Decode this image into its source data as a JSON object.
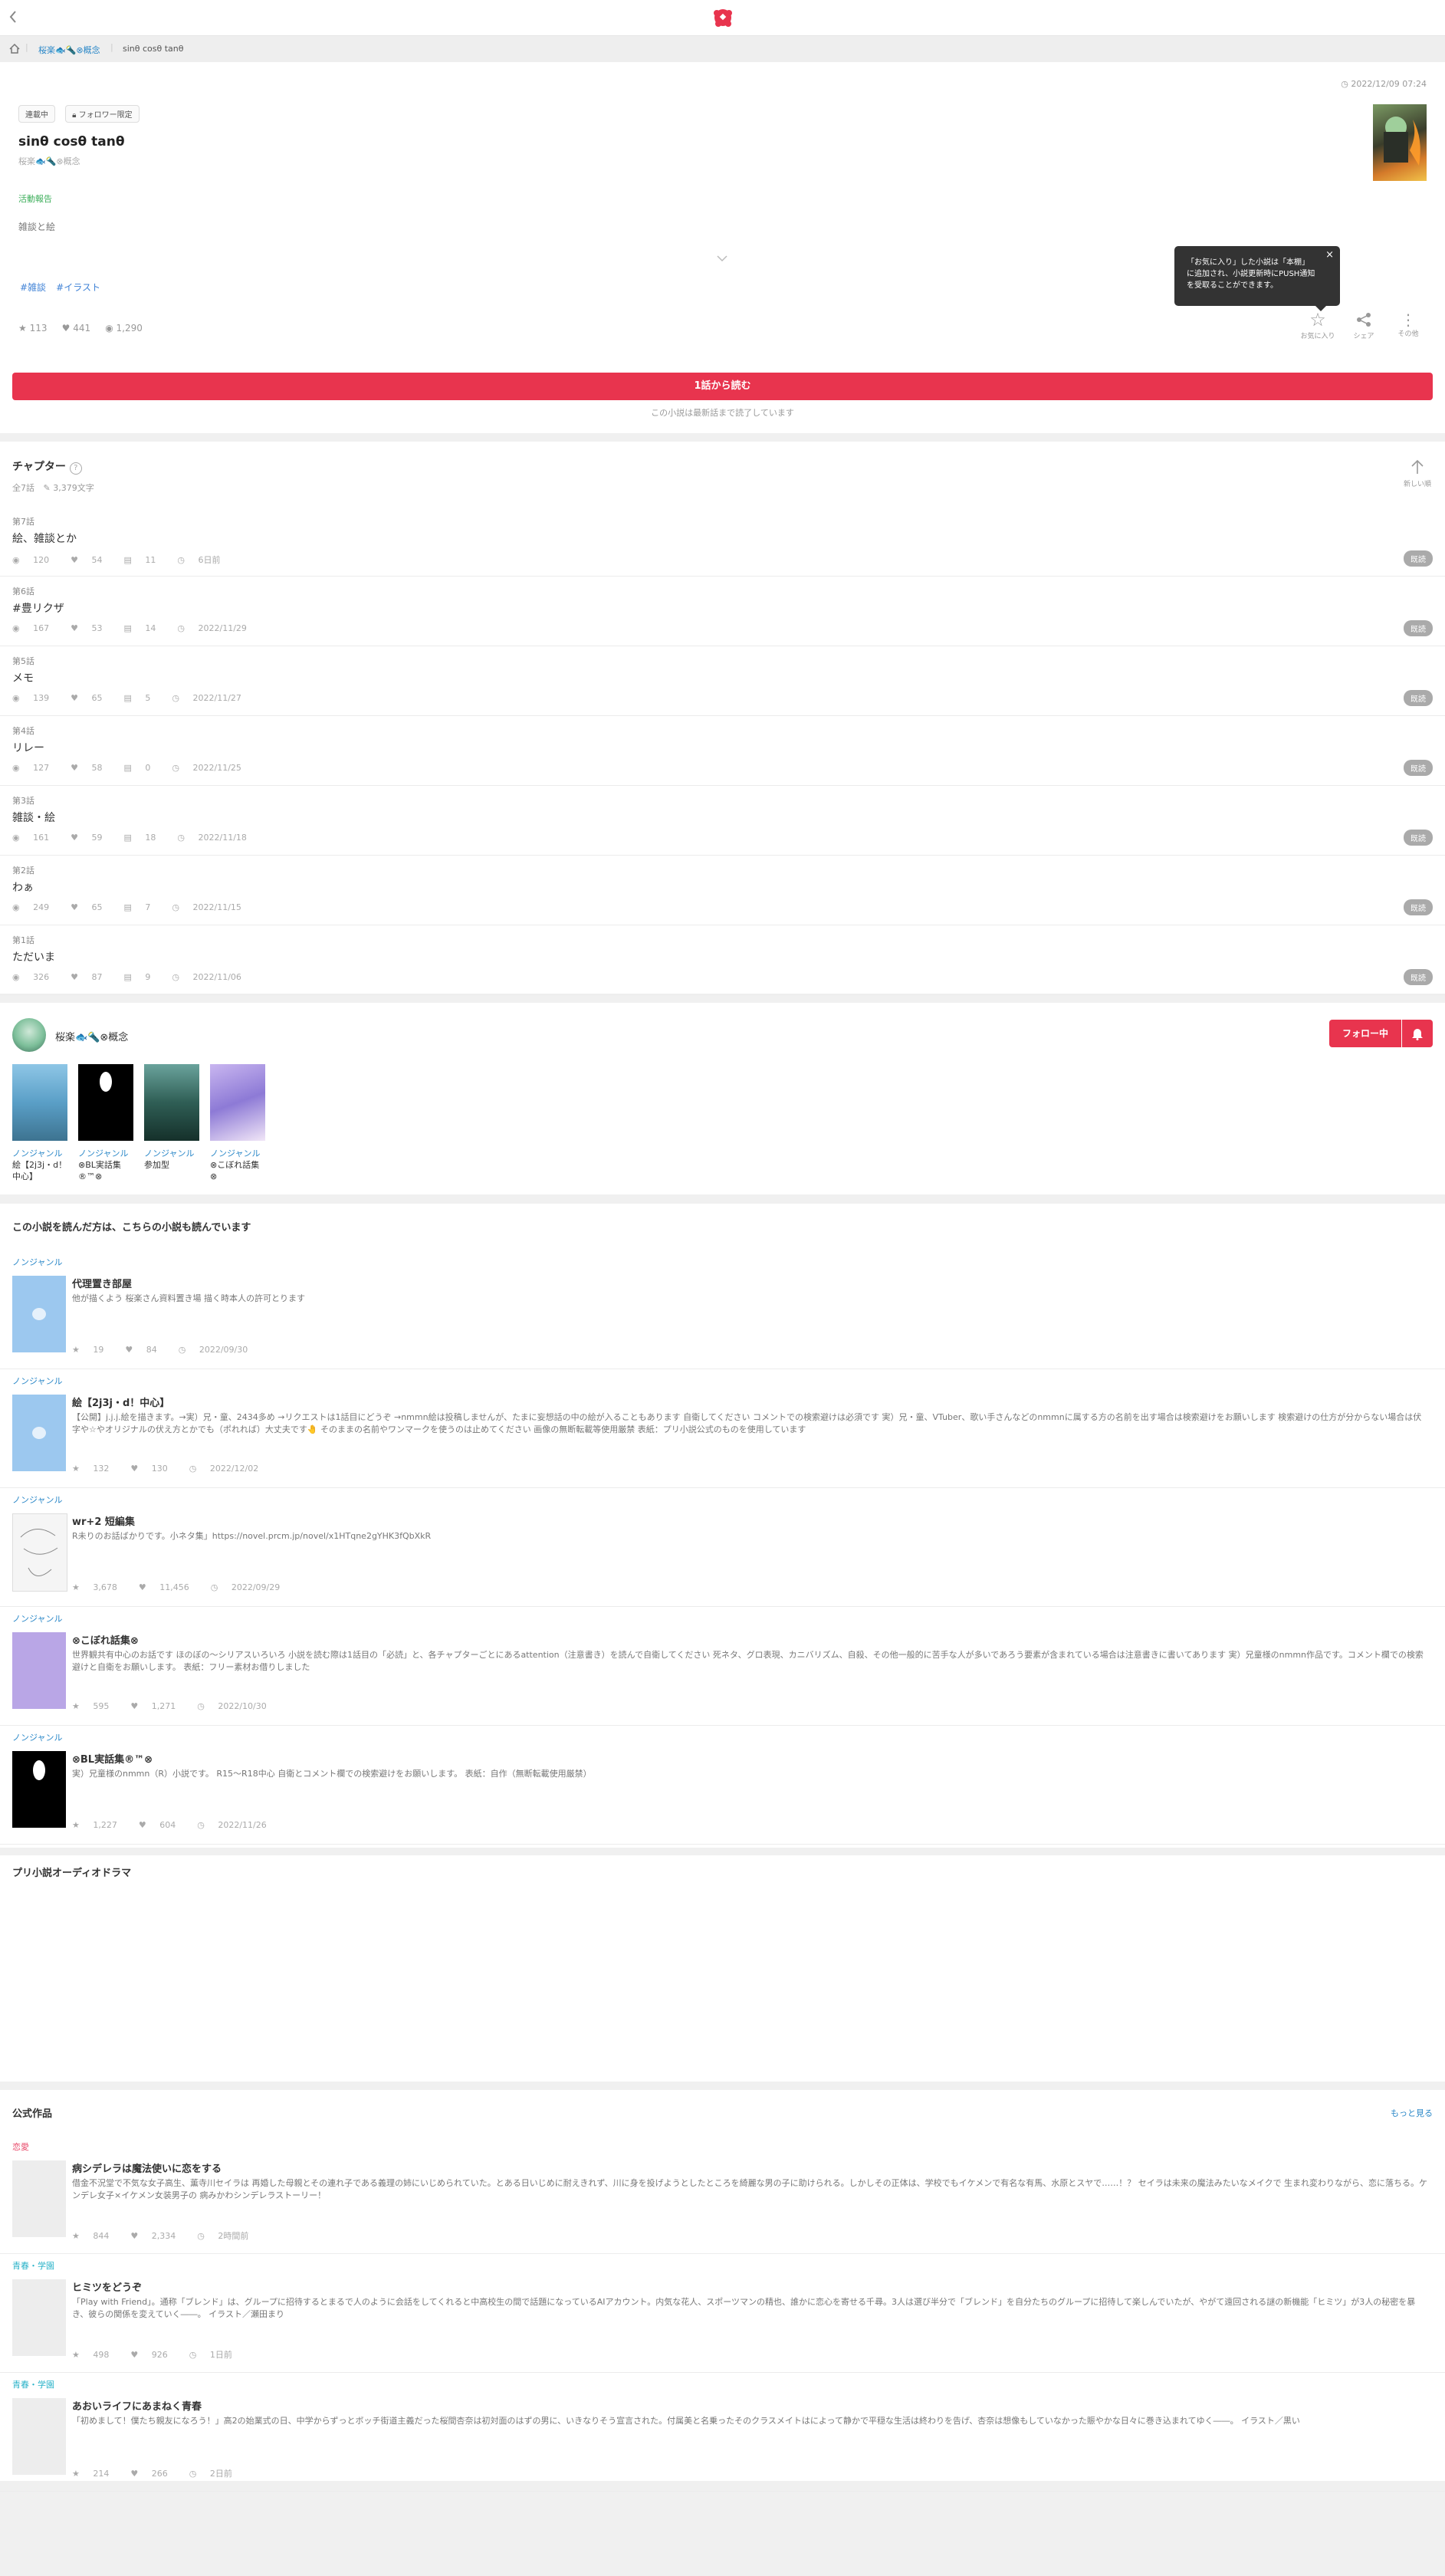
{
  "header": {
    "back_icon": "chevron-left-icon",
    "logo_icon": "prism-logo-icon"
  },
  "breadcrumb": {
    "home_icon": "home-icon",
    "author": "桜楽🐟🔦⊗概念",
    "current": "sinθ cosθ tanθ"
  },
  "novel": {
    "date": "2022/12/09 07:24",
    "status_tag": "連載中",
    "follower_tag": "フォロワー限定",
    "title": "sinθ cosθ tanθ",
    "author": "桜楽🐟🔦⊗概念",
    "genre": "活動報告",
    "summary": "雑談と絵",
    "hashtags": [
      "#雑談",
      "#イラスト"
    ],
    "stats": {
      "stars": "113",
      "hearts": "441",
      "views": "1,290"
    },
    "tooltip": "「お気に入り」した小説は「本棚」に追加され、小説更新時にPUSH通知を受取ることができます。",
    "actions": {
      "favorite": "お気に入り",
      "share": "シェア",
      "other": "その他"
    },
    "read_button": "1話から読む",
    "note": "この小説は最新話まで読了しています"
  },
  "chapters_section": {
    "title": "チャプター",
    "summary_count": "全7話",
    "summary_chars": "3,379文字",
    "sort_label": "新しい順",
    "items": [
      {
        "num": "第7話",
        "title": "絵、雑談とか",
        "views": "120",
        "hearts": "54",
        "comments": "11",
        "date": "6日前",
        "badge": "既読"
      },
      {
        "num": "第6話",
        "title": "#豊リクザ",
        "views": "167",
        "hearts": "53",
        "comments": "14",
        "date": "2022/11/29",
        "badge": "既読"
      },
      {
        "num": "第5話",
        "title": "メモ",
        "views": "139",
        "hearts": "65",
        "comments": "5",
        "date": "2022/11/27",
        "badge": "既読"
      },
      {
        "num": "第4話",
        "title": "リレー",
        "views": "127",
        "hearts": "58",
        "comments": "0",
        "date": "2022/11/25",
        "badge": "既読"
      },
      {
        "num": "第3話",
        "title": "雑談・絵",
        "views": "161",
        "hearts": "59",
        "comments": "18",
        "date": "2022/11/18",
        "badge": "既読"
      },
      {
        "num": "第2話",
        "title": "わぁ",
        "views": "249",
        "hearts": "65",
        "comments": "7",
        "date": "2022/11/15",
        "badge": "既読"
      },
      {
        "num": "第1話",
        "title": "ただいま",
        "views": "326",
        "hearts": "87",
        "comments": "9",
        "date": "2022/11/06",
        "badge": "既読"
      }
    ]
  },
  "author_section": {
    "name": "桜楽🐟🔦⊗概念",
    "follow_label": "フォロー中",
    "works": [
      {
        "genre": "ノンジャンル",
        "title": "絵【2j3j・d！中心】",
        "cover": "#6aa9cc"
      },
      {
        "genre": "ノンジャンル",
        "title": "⊗BL実話集®™⊗",
        "cover": "#000000"
      },
      {
        "genre": "ノンジャンル",
        "title": "参加型",
        "cover": "#2f5e55"
      },
      {
        "genre": "ノンジャンル",
        "title": "⊗こぼれ話集⊗",
        "cover": "#a58ad8"
      }
    ]
  },
  "recommend_section": {
    "title": "この小説を読んだ方は、こちらの小説も読んでいます",
    "items": [
      {
        "genre": "ノンジャンル",
        "title": "代理置き部屋",
        "desc": "他が描くよう 桜楽さん資料置き場 描く時本人の許可とります",
        "stars": "19",
        "hearts": "84",
        "date": "2022/09/30",
        "cover": "#9cc8ef"
      },
      {
        "genre": "ノンジャンル",
        "title": "絵【2j3j・d！中心】",
        "desc": "【公開】j.j.j.絵を描きます。→実）兄・童、2434多め →リクエストは1話目にどうぞ →nmmn絵は投稿しませんが、たまに妄想話の中の絵が入ることもあります 自衛してください コメントでの検索避けは必須です 実）兄・童、VTuber、歌い手さんなどのnmmnに属する方の名前を出す場合は検索避けをお願いします 検索避けの仕方が分からない場合は伏字や☆やオリジナルの伏え方とかでも（ポれれば）大丈夫です🤚 そのままの名前やワンマークを使うのは止めてください 画像の無断転載等使用厳禁 表紙：プリ小説公式のものを使用しています",
        "stars": "132",
        "hearts": "130",
        "date": "2022/12/02",
        "cover": "#9cc8ef"
      },
      {
        "genre": "ノンジャンル",
        "title": "wr+2 短編集",
        "desc": "R未りのお話ばかりです。小ネタ集」https://novel.prcm.jp/novel/x1HTqne2gYHK3fQbXkR",
        "stars": "3,678",
        "hearts": "11,456",
        "date": "2022/09/29",
        "cover": "#f5f5f5"
      },
      {
        "genre": "ノンジャンル",
        "title": "⊗こぼれ話集⊗",
        "desc": "世界観共有中心のお話です ほのぼの〜シリアスいろいろ 小説を読む際は1話目の「必読」と、各チャプターごとにあるattention（注意書き）を読んで自衛してください 死ネタ、グロ表現、カニバリズム、自殺、その他一般的に苦手な人が多いであろう要素が含まれている場合は注意書きに書いてあります 実）兄童様のnmmn作品です。コメント欄での検索避けと自衛をお願いします。 表紙：フリー素材お借りしました",
        "stars": "595",
        "hearts": "1,271",
        "date": "2022/10/30",
        "cover": "#b9a6e6"
      },
      {
        "genre": "ノンジャンル",
        "title": "⊗BL実話集®™⊗",
        "desc": "実）兄童様のnmmn（R）小説です。 R15〜R18中心 自衛とコメント欄での検索避けをお願いします。 表紙：自作（無断転載使用厳禁）",
        "stars": "1,227",
        "hearts": "604",
        "date": "2022/11/26",
        "cover": "#000000"
      }
    ]
  },
  "drama_section": {
    "title": "プリ小説オーディオドラマ"
  },
  "official_section": {
    "title": "公式作品",
    "more_label": "もっと見る",
    "items": [
      {
        "genre": "恋愛",
        "genre_color": "#e84a6a",
        "title": "病シデレラは魔法使いに恋をする",
        "desc": "借金不況堂で不気な女子高生、薫寺川セイラは 再婚した母親とその連れ子である義理の姉にいじめられていた。とある日いじめに耐えきれず、川に身を投げようとしたところを綺麗な男の子に助けられる。しかしその正体は、学校でもイケメンで有名な有馬、水原とスヤで……！？ セイラは未来の魔法みたいなメイクで 生まれ変わりながら、恋に落ちる。ケンデレ女子×イケメン女装男子の 病みかわシンデレラストーリー！",
        "stars": "844",
        "hearts": "2,334",
        "date": "2時間前"
      },
      {
        "genre": "青春・学園",
        "genre_color": "#2bb3c9",
        "title": "ヒミツをどうぞ",
        "desc": "「Play with Friend」。通称「ブレンド」は、グループに招待するとまるで人のように会話をしてくれると中高校生の間で話題になっているAIアカウント。内気な花人、スポーツマンの精也、誰かに恋心を寄せる千尋。3人は選び半分で「ブレンド」を自分たちのグループに招待して楽しんでいたが、やがて遠回される謎の新機能「ヒミツ」が3人の秘密を暴き、彼らの関係を変えていく――。 イラスト／瀬田まり",
        "stars": "498",
        "hearts": "926",
        "date": "1日前"
      },
      {
        "genre": "青春・学園",
        "genre_color": "#2bb3c9",
        "title": "あおいライフにあまねく青春",
        "desc": "「初めまして！僕たち親友になろう！」高2の始業式の日、中学からずっとボッチ街道主義だった桜間杏奈は初対面のはずの男に、いきなりそう宣言された。付属美と名乗ったそのクラスメイトはによって静かで平穏な生活は終わりを告げ、杏奈は想像もしていなかった賑やかな日々に巻き込まれてゆく――。 イラスト／黒い",
        "stars": "214",
        "hearts": "266",
        "date": "2日前"
      }
    ]
  },
  "colors": {
    "accent": "#e8344e",
    "link": "#2b88c8",
    "hashtag": "#3f82d6",
    "genre_green": "#3cae5a"
  }
}
